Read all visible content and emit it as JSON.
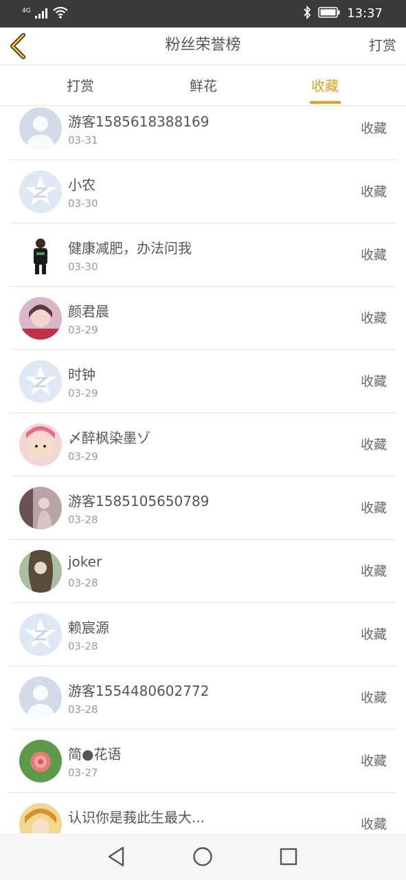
{
  "status_bar": {
    "network": "4G",
    "time": "13:37",
    "icons": [
      "signal-icon",
      "wifi-icon",
      "bluetooth-icon",
      "battery-icon"
    ]
  },
  "header": {
    "title": "粉丝荣誉榜",
    "action_label": "打赏",
    "back_icon": "chevron-left-icon"
  },
  "tabs": [
    {
      "label": "打赏",
      "active": false
    },
    {
      "label": "鲜花",
      "active": false
    },
    {
      "label": "收藏",
      "active": true
    }
  ],
  "colors": {
    "accent": "#e8a018",
    "status_bar": "#3a3a3a",
    "text": "#555555",
    "subtext": "#9a9a9a"
  },
  "list": [
    {
      "name": "游客1585618388169",
      "date": "03-31",
      "action": "收藏",
      "avatar": "default-person-avatar"
    },
    {
      "name": "小农",
      "date": "03-30",
      "action": "收藏",
      "avatar": "qzone-star-avatar"
    },
    {
      "name": "健康减肥，办法问我",
      "date": "03-30",
      "action": "收藏",
      "avatar": "photo-avatar"
    },
    {
      "name": "颜君晨",
      "date": "03-29",
      "action": "收藏",
      "avatar": "photo-avatar"
    },
    {
      "name": "时钟",
      "date": "03-29",
      "action": "收藏",
      "avatar": "qzone-star-avatar"
    },
    {
      "name": "〆醉枫染墨ゾ",
      "date": "03-29",
      "action": "收藏",
      "avatar": "photo-avatar"
    },
    {
      "name": "游客1585105650789",
      "date": "03-28",
      "action": "收藏",
      "avatar": "photo-avatar"
    },
    {
      "name": "joker",
      "date": "03-28",
      "action": "收藏",
      "avatar": "photo-avatar"
    },
    {
      "name": "赖宸源",
      "date": "03-28",
      "action": "收藏",
      "avatar": "qzone-star-avatar"
    },
    {
      "name": "游客1554480602772",
      "date": "03-28",
      "action": "收藏",
      "avatar": "default-person-avatar"
    },
    {
      "name": "简●花语",
      "date": "03-27",
      "action": "收藏",
      "avatar": "photo-avatar"
    },
    {
      "name": "认识你是莪此生最大...",
      "date": "",
      "action": "收藏",
      "avatar": "photo-avatar"
    }
  ],
  "navbar": {
    "icons": [
      "back-triangle-icon",
      "home-circle-icon",
      "recents-square-icon"
    ]
  }
}
